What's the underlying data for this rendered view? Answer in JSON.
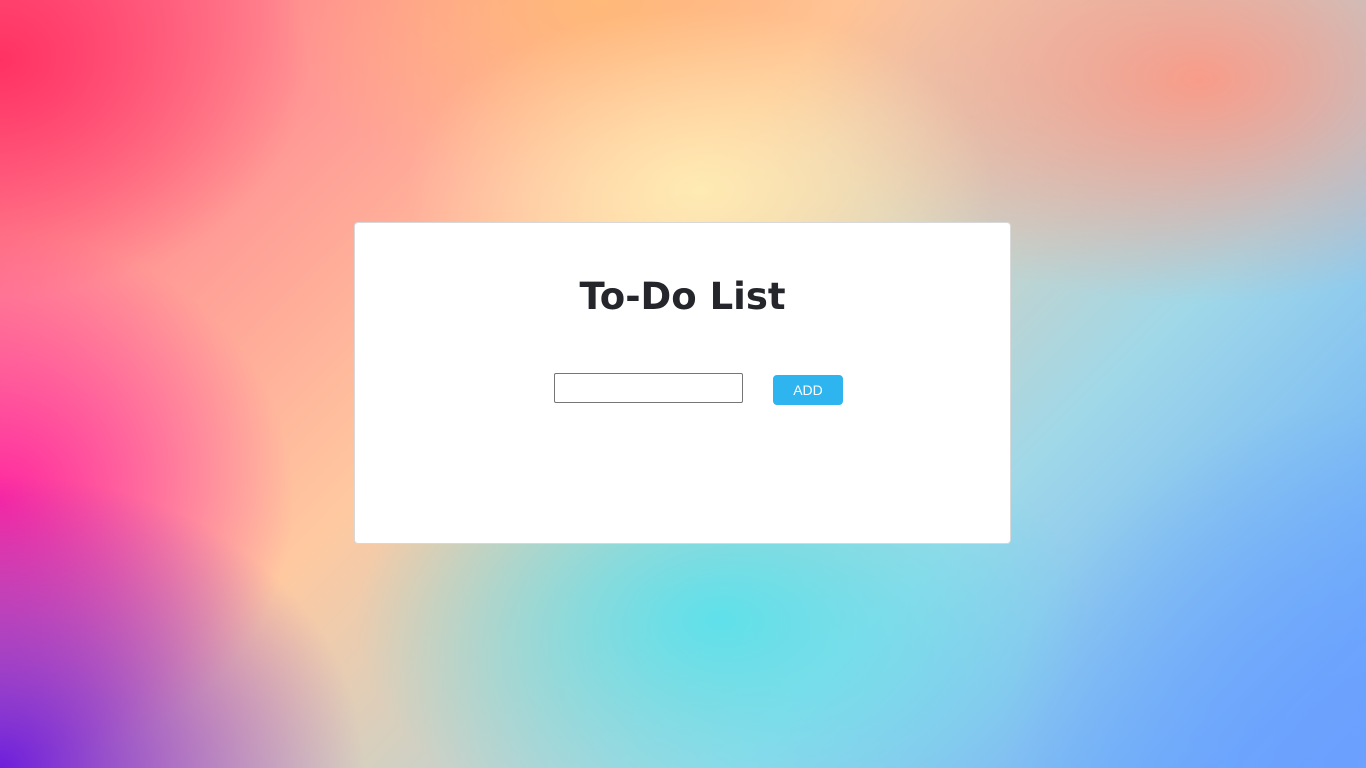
{
  "app": {
    "title": "To-Do List"
  },
  "form": {
    "input_value": "",
    "input_placeholder": "",
    "add_label": "ADD"
  },
  "colors": {
    "accent": "#2eb4ee",
    "card_background": "#ffffff",
    "title_text": "#24262b"
  },
  "todos": []
}
